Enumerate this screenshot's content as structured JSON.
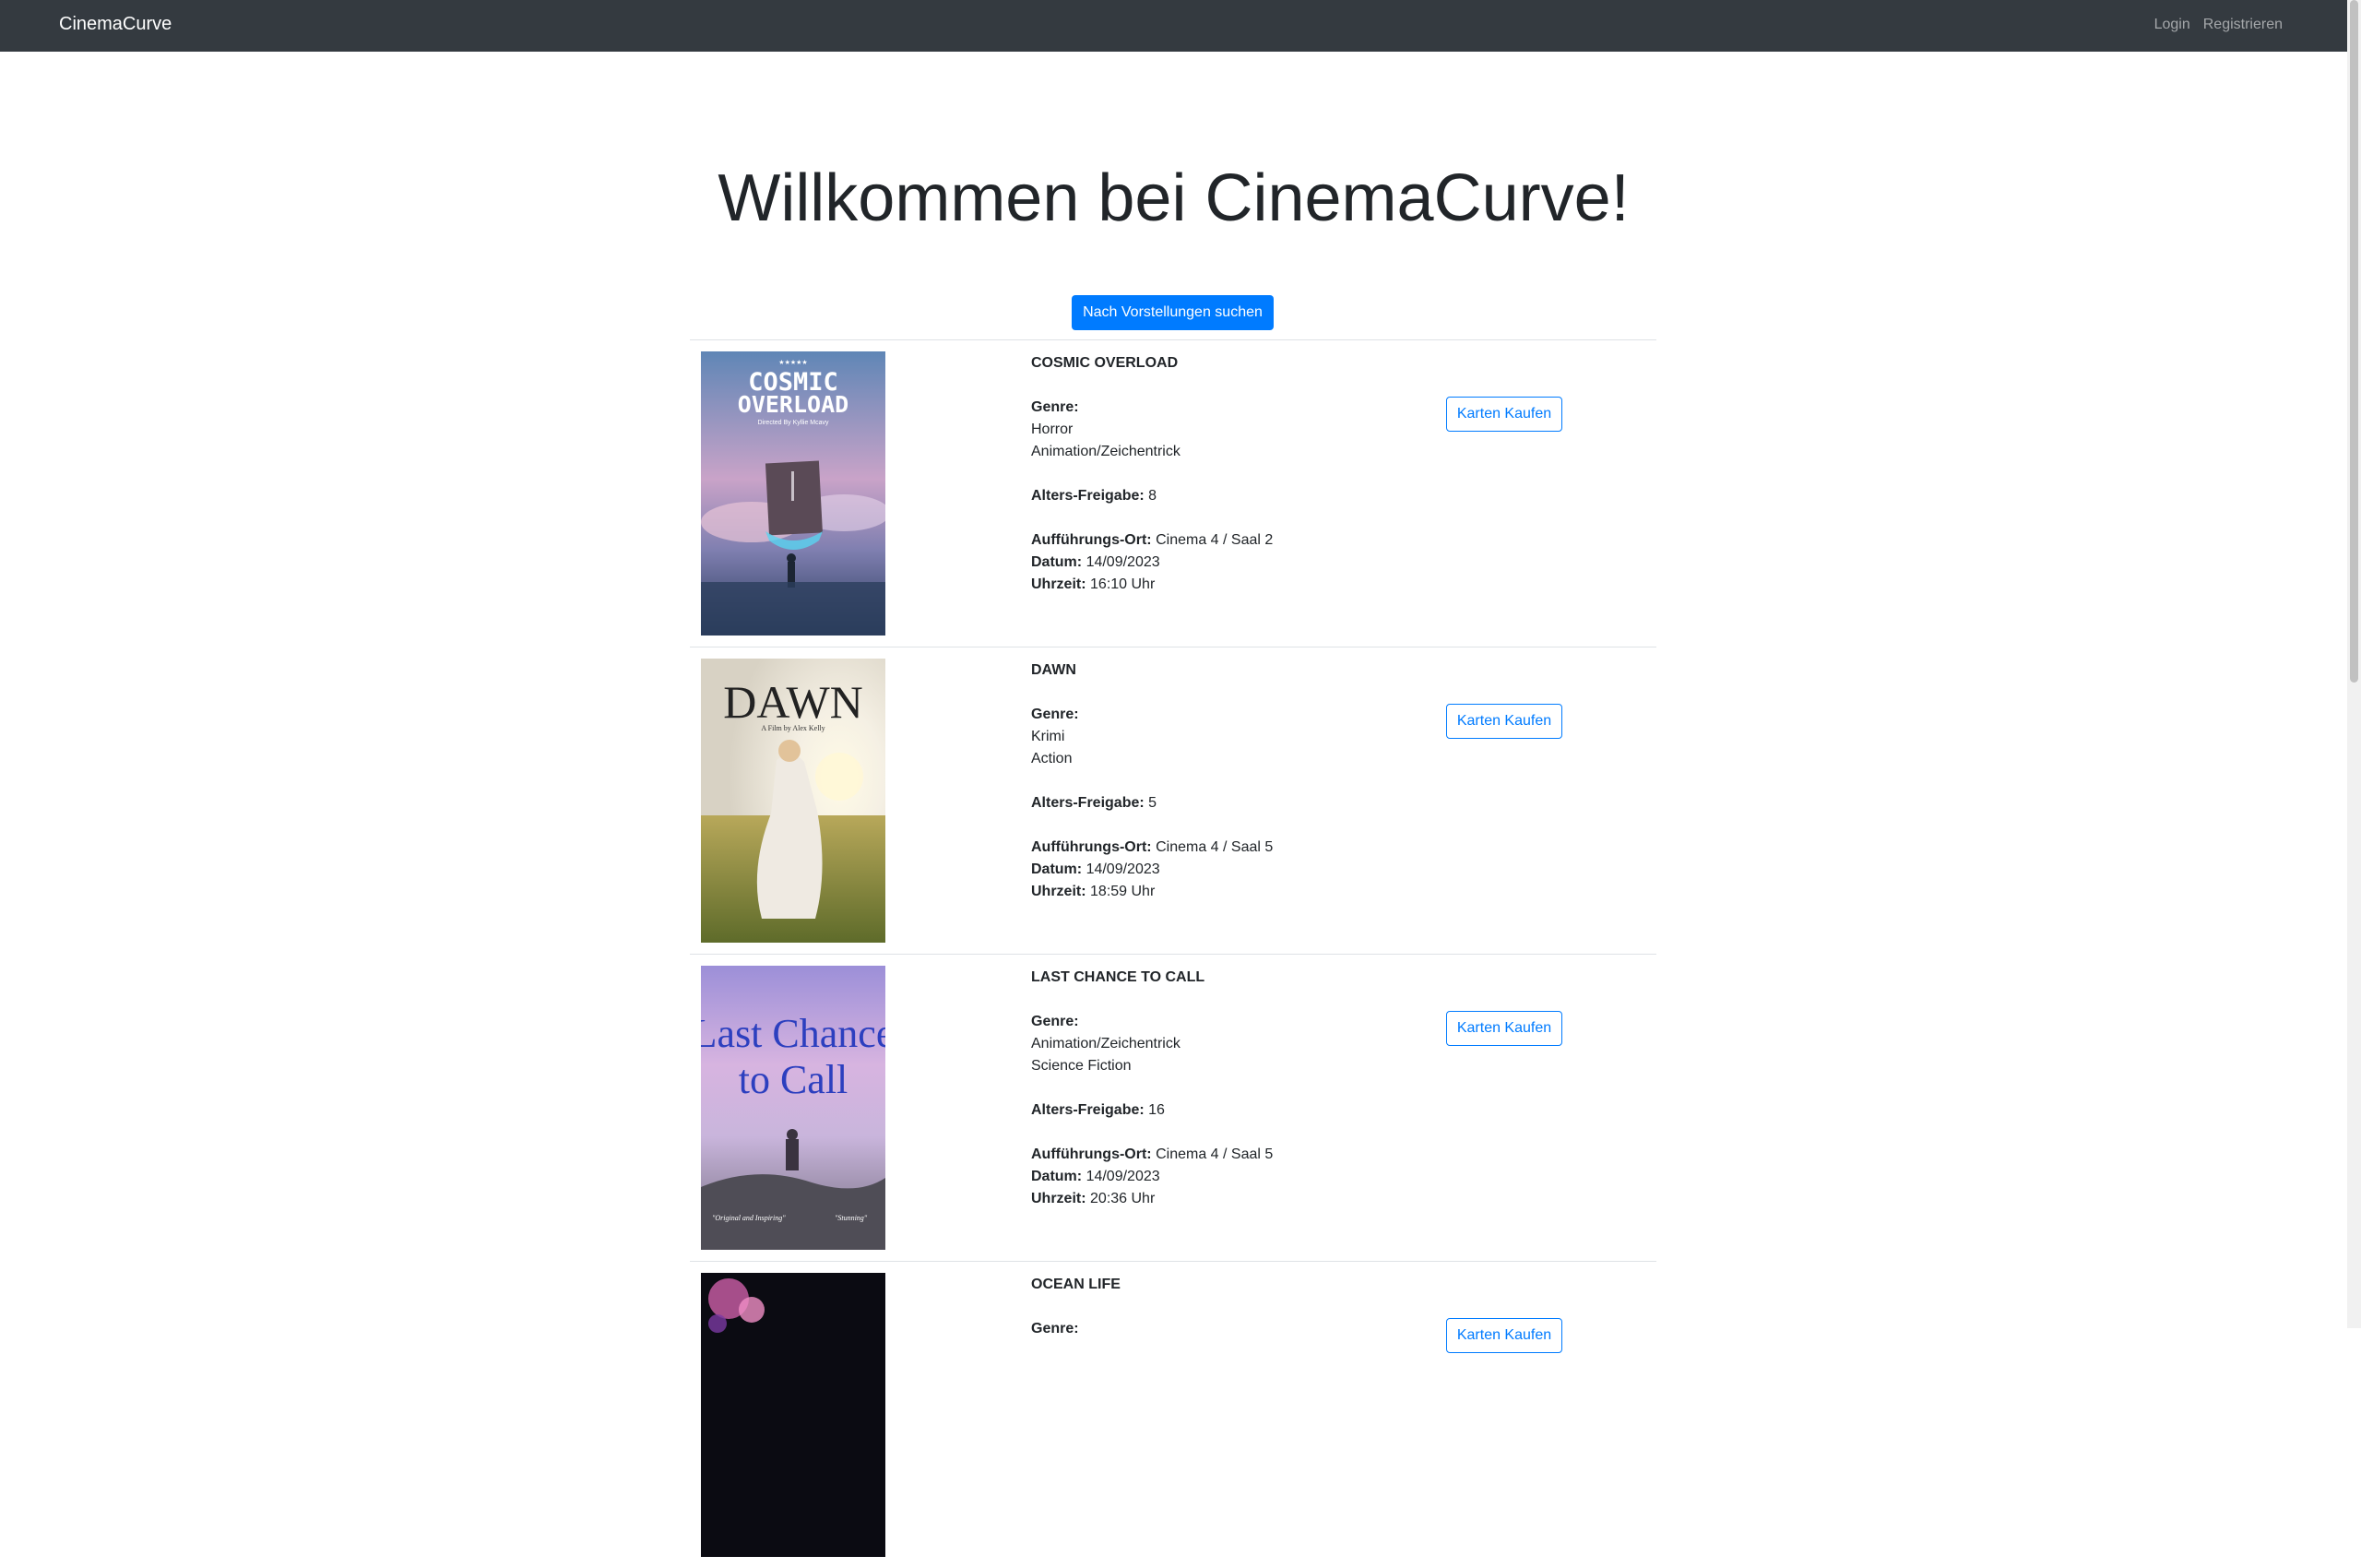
{
  "nav": {
    "brand": "CinemaCurve",
    "login": "Login",
    "register": "Registrieren"
  },
  "hero": {
    "title": "Willkommen bei CinemaCurve!",
    "search_button": "Nach Vorstellungen suchen"
  },
  "labels": {
    "genre": "Genre:",
    "age": "Alters-Freigabe:",
    "venue": "Aufführungs-Ort:",
    "date": "Datum:",
    "time": "Uhrzeit:",
    "buy": "Karten Kaufen"
  },
  "movies": [
    {
      "title": "COSMIC OVERLOAD",
      "genres": [
        "Horror",
        "Animation/Zeichentrick"
      ],
      "age": "8",
      "venue": "Cinema 4 / Saal 2",
      "date": "14/09/2023",
      "time": "16:10 Uhr",
      "poster": {
        "line1": "COSMIC",
        "line2": "OVERLOAD",
        "sub": "Directed By Kyllie Mcavy",
        "top": "★★★★★"
      }
    },
    {
      "title": "DAWN",
      "genres": [
        "Krimi",
        "Action"
      ],
      "age": "5",
      "venue": "Cinema 4 / Saal 5",
      "date": "14/09/2023",
      "time": "18:59 Uhr",
      "poster": {
        "line1": "DAWN",
        "sub": "A Film by Alex Kelly"
      }
    },
    {
      "title": "LAST CHANCE TO CALL",
      "genres": [
        "Animation/Zeichentrick",
        "Science Fiction"
      ],
      "age": "16",
      "venue": "Cinema 4 / Saal 5",
      "date": "14/09/2023",
      "time": "20:36 Uhr",
      "poster": {
        "line1": "Last Chance",
        "line2": "to Call",
        "quote1": "\"Original and Inspiring\"",
        "quote2": "\"Stunning\""
      }
    },
    {
      "title": "OCEAN LIFE"
    }
  ]
}
